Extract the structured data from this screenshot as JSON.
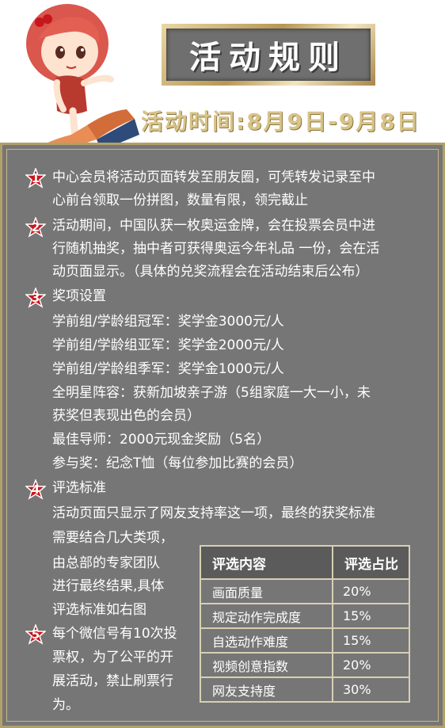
{
  "title": "活动规则",
  "date": "活动时间:8月9日-9月8日",
  "items": [
    {
      "num": "1",
      "lines": [
        "中心会员将活动页面转发至朋友圈，可凭转发记录至中",
        "心前台领取一份拼图，数量有限，领完截止"
      ]
    },
    {
      "num": "2",
      "lines": [
        "活动期间，中国队获一枚奥运金牌，会在投票会员中进",
        "行随机抽奖，抽中者可获得奥运今年礼品 一份，会在活",
        "动页面显示。（具体的兑奖流程会在活动结束后公布）"
      ]
    },
    {
      "num": "3",
      "heading": "奖项设置",
      "lines": [
        "学前组/学龄组冠军：奖学金3000元/人",
        "学前组/学龄组亚军：奖学金2000元/人",
        "学前组/学龄组季军：奖学金1000元/人",
        "全明星阵容：获新加坡亲子游（5组家庭一大一小，未",
        "获奖但表现出色的会员）",
        "最佳导师：2000元现金奖励（5名）",
        "参与奖：纪念T恤（每位参加比赛的会员）"
      ]
    },
    {
      "num": "4",
      "heading": "评选标准",
      "lines": [
        "活动页面只显示了网友支持率这一项，最终的获奖标准",
        "需要结合几大类项，",
        "由总部的专家团队",
        "进行最终结果,具体",
        "评选标准如右图"
      ]
    },
    {
      "num": "5",
      "lines": [
        "每个微信号有10次投",
        "票权，为了公平的开",
        "展活动，禁止刷票行",
        "为。"
      ]
    }
  ],
  "table": {
    "headers": [
      "评选内容",
      "评选占比"
    ],
    "rows": [
      [
        "画面质量",
        "20%"
      ],
      [
        "规定动作完成度",
        "15%"
      ],
      [
        "自选动作难度",
        "15%"
      ],
      [
        "视频创意指数",
        "20%"
      ],
      [
        "网友支持度",
        "30%"
      ]
    ]
  },
  "colors": {
    "panel": "#767676",
    "badge": "#c8161d",
    "gold": "#d8c388"
  }
}
